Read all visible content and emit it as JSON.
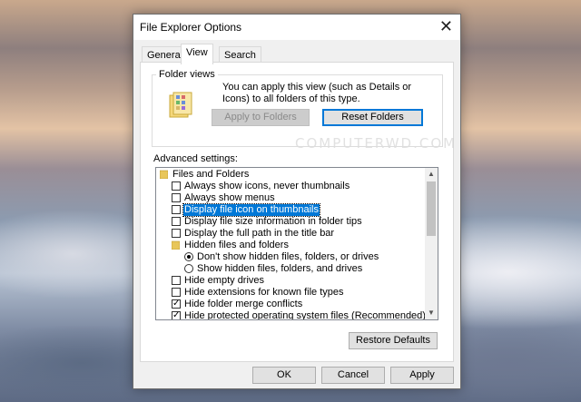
{
  "dialog": {
    "title": "File Explorer Options",
    "close_label": "✕",
    "tabs": [
      {
        "label": "General"
      },
      {
        "label": "View"
      },
      {
        "label": "Search"
      }
    ],
    "active_tab": "View"
  },
  "folder_views": {
    "title": "Folder views",
    "description": "You can apply this view (such as Details or Icons) to all folders of this type.",
    "apply_button": "Apply to Folders",
    "reset_button": "Reset Folders"
  },
  "advanced": {
    "label": "Advanced settings:",
    "items": [
      {
        "type": "folder",
        "label": "Files and Folders"
      },
      {
        "type": "checkbox",
        "checked": false,
        "label": "Always show icons, never thumbnails"
      },
      {
        "type": "checkbox",
        "checked": false,
        "label": "Always show menus"
      },
      {
        "type": "checkbox",
        "checked": false,
        "label": "Display file icon on thumbnails",
        "selected": true
      },
      {
        "type": "checkbox",
        "checked": false,
        "label": "Display file size information in folder tips"
      },
      {
        "type": "checkbox",
        "checked": false,
        "label": "Display the full path in the title bar"
      },
      {
        "type": "folder",
        "label": "Hidden files and folders"
      },
      {
        "type": "radio",
        "checked": true,
        "label": "Don't show hidden files, folders, or drives"
      },
      {
        "type": "radio",
        "checked": false,
        "label": "Show hidden files, folders, and drives"
      },
      {
        "type": "checkbox",
        "checked": false,
        "label": "Hide empty drives"
      },
      {
        "type": "checkbox",
        "checked": false,
        "label": "Hide extensions for known file types"
      },
      {
        "type": "checkbox",
        "checked": true,
        "label": "Hide folder merge conflicts"
      },
      {
        "type": "checkbox",
        "checked": true,
        "label": "Hide protected operating system files (Recommended)"
      }
    ],
    "restore_button": "Restore Defaults"
  },
  "footer": {
    "ok": "OK",
    "cancel": "Cancel",
    "apply": "Apply"
  },
  "watermark": "COMPUTERWD.COM",
  "colors": {
    "accent": "#0078d7",
    "selection": "#0078d7",
    "folder": "#e8c65a"
  }
}
